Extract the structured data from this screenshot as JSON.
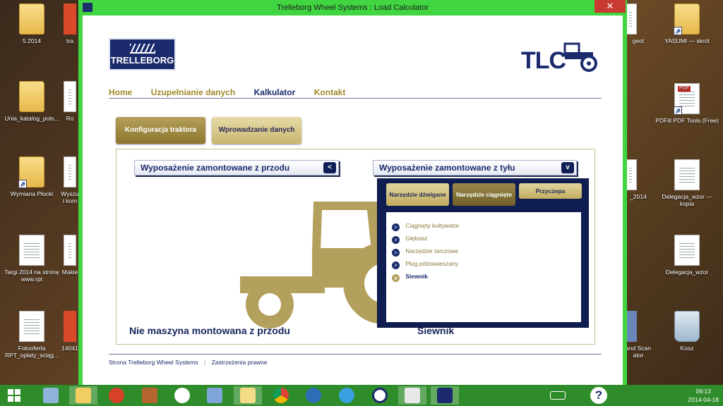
{
  "window": {
    "title": "Trelleborg Wheel Systems : Load Calculator",
    "close_glyph": "✕",
    "accent_border": "#41d641"
  },
  "brand": {
    "logo_text": "TRELLEBORG",
    "tlc_text": "TLC"
  },
  "nav": {
    "items": [
      "Home",
      "Uzupełnianie danych",
      "Kalkulator",
      "Kontakt"
    ],
    "active": "Kalkulator"
  },
  "tabs": {
    "config": "Konfiguracja traktora",
    "input": "Wprowadzanie danych"
  },
  "front": {
    "select_label": "Wyposażenie zamontowane z przodu",
    "arrow": "<",
    "caption": "Nie maszyna montowana z przodu"
  },
  "rear": {
    "select_label": "Wyposażenie zamontowane z tyłu",
    "arrow": "v",
    "caption": "Siewnik",
    "tool_buttons": [
      {
        "label": "Narzędzie dźwigane",
        "style": "light"
      },
      {
        "label": "Narzędzie ciągnięte",
        "style": "dark"
      },
      {
        "label": "Przyczepa",
        "style": "light"
      }
    ],
    "items": [
      {
        "label": "Ciągnięty kultywator",
        "selected": false
      },
      {
        "label": "Głębosz",
        "selected": false
      },
      {
        "label": "Narzędzie tarczowe",
        "selected": false
      },
      {
        "label": "Pług półzawieszany",
        "selected": false
      },
      {
        "label": "Siewnik",
        "selected": true
      }
    ],
    "bullet": ">",
    "bullet_selected": "v"
  },
  "footer": {
    "link1": "Strona Trelleborg Wheel Systems",
    "separator": "|",
    "link2": "Zastrzeżenia prawne"
  },
  "desktop_icons": [
    {
      "label": "5.2014",
      "type": "folder"
    },
    {
      "label": "Unia_katalog_pols...",
      "type": "folder"
    },
    {
      "label": "Wymiana Płocki",
      "type": "folder"
    },
    {
      "label": "Targi 2014 na stronę www.rpt",
      "type": "doc"
    },
    {
      "label": "Fotooferta RPT_opłaty_sciąg...",
      "type": "doc"
    },
    {
      "label": "tra",
      "type": "doc"
    },
    {
      "label": "Ro",
      "type": "doc"
    },
    {
      "label": "Wyszu i kom",
      "type": "doc"
    },
    {
      "label": "Makie",
      "type": "doc"
    },
    {
      "label": "14041",
      "type": "doc"
    },
    {
      "label": "geot",
      "type": "doc"
    },
    {
      "label": "YASUMI — skrót",
      "type": "folder"
    },
    {
      "label": "PDFill PDF Tools (Free)",
      "type": "app"
    },
    {
      "label": "_2014",
      "type": "doc"
    },
    {
      "label": "Delegacja_wzor — kopia",
      "type": "doc"
    },
    {
      "label": "Delegacja_wzor",
      "type": "doc"
    },
    {
      "label": "and Scan ator",
      "type": "doc"
    },
    {
      "label": "Kosz",
      "type": "bin"
    }
  ],
  "taskbar": {
    "apps": [
      "start-icon",
      "calculator-icon",
      "file-explorer-icon",
      "power-icon",
      "tools-icon",
      "hp-icon",
      "network-icon",
      "folder-icon",
      "chrome-icon",
      "thunderbird-icon",
      "ie-icon",
      "app-icon",
      "document-icon",
      "tlc-app-icon"
    ],
    "help": "?",
    "time": "09:13",
    "date": "2014-04-18"
  }
}
